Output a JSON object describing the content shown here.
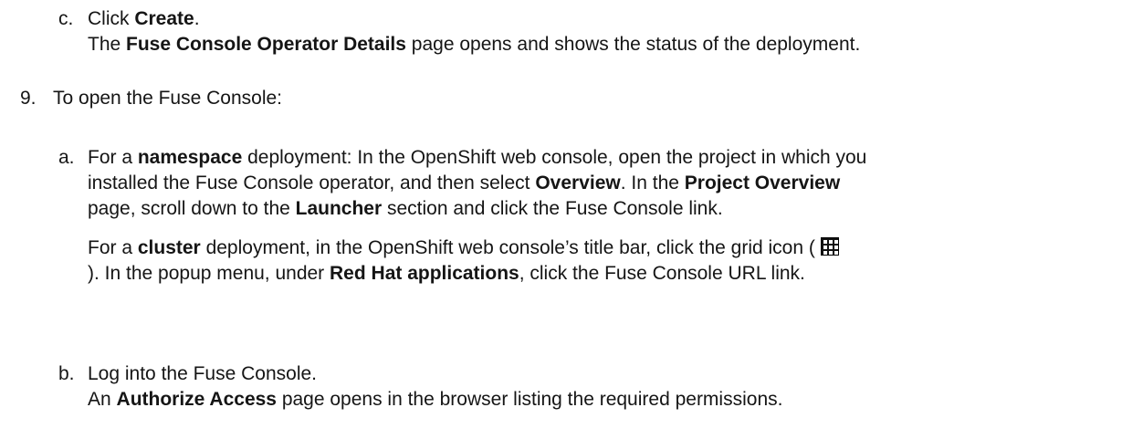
{
  "step_c": {
    "marker": "c.",
    "prefix": "Click ",
    "bold": "Create",
    "suffix": ".",
    "result_bold": "Fuse Console Operator Details",
    "result_text": " page opens and shows the status of the deployment.",
    "result_prefix": "The "
  },
  "step_9": {
    "marker": "9.",
    "text": "To open the Fuse Console:"
  },
  "step_a": {
    "marker": "a.",
    "p1": {
      "t1": "For a ",
      "b1": "namespace",
      "t2": " deployment: In the OpenShift web console, open the project in which you",
      "t3": "installed the Fuse Console operator, and then select ",
      "b2": "Overview",
      "t4": ". In the ",
      "b3": "Project Overview",
      "t5": "page, scroll down to the ",
      "b4": "Launcher",
      "t6": " section and click the Fuse Console link."
    },
    "p2": {
      "t1": "For a ",
      "b1": "cluster",
      "t2": " deployment, in the OpenShift web console’s title bar, click the grid icon ( ",
      "icon": "grid-icon",
      "t3": "). In the popup menu, under ",
      "b2": "Red Hat applications",
      "t4": ", click the Fuse Console URL link."
    }
  },
  "step_b": {
    "marker": "b.",
    "text": "Log into the Fuse Console.",
    "result_prefix": "An ",
    "result_bold": "Authorize Access",
    "result_text": " page opens in the browser listing the required permissions."
  }
}
